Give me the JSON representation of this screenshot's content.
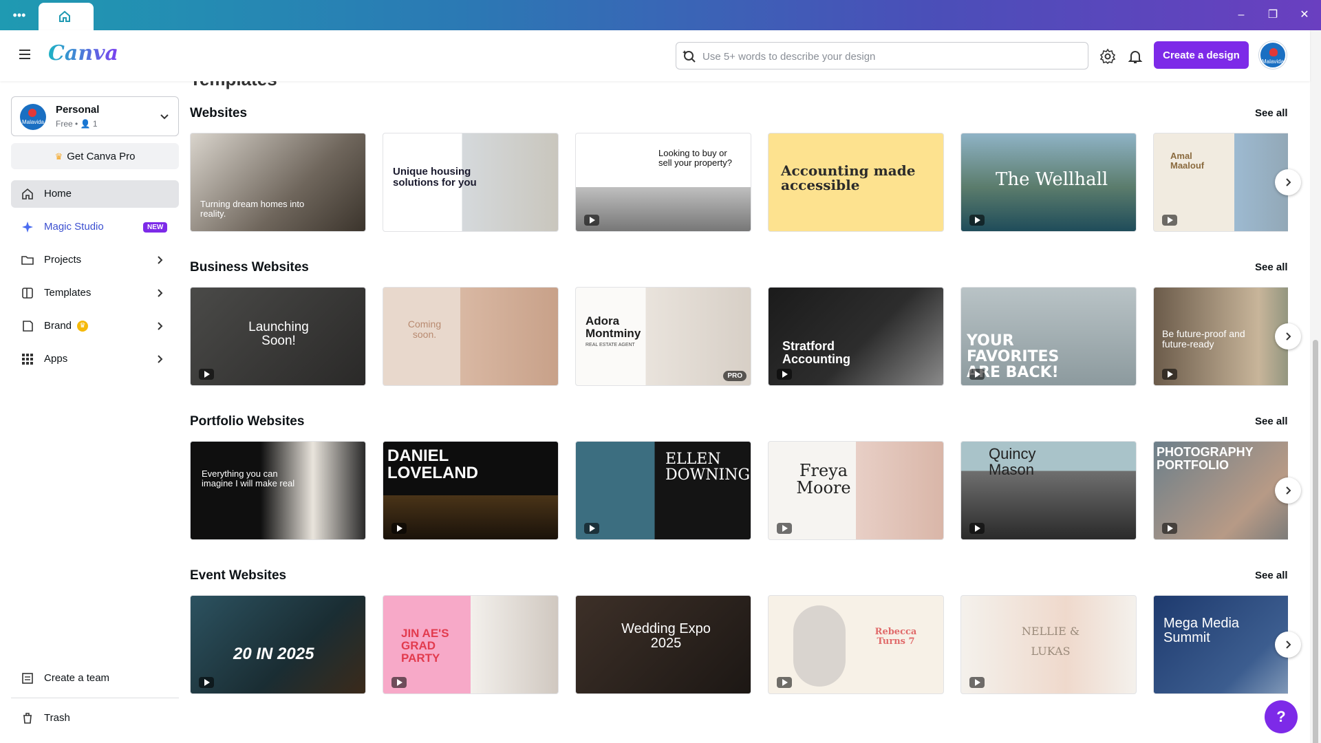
{
  "browser": {
    "tab_label": "Home"
  },
  "header": {
    "logo": "Canva",
    "search_placeholder": "Use 5+ words to describe your design",
    "create_label": "Create a design",
    "avatar_text": "Malavida"
  },
  "sidebar": {
    "account": {
      "name": "Personal",
      "plan": "Free • 👤 1",
      "avatar_text": "Malavida"
    },
    "get_pro": "Get Canva Pro",
    "items": [
      {
        "label": "Home",
        "icon": "home-icon"
      },
      {
        "label": "Magic Studio",
        "icon": "sparkle-icon",
        "badge": "NEW"
      },
      {
        "label": "Projects",
        "icon": "folder-icon"
      },
      {
        "label": "Templates",
        "icon": "templates-icon"
      },
      {
        "label": "Brand",
        "icon": "brand-icon"
      },
      {
        "label": "Apps",
        "icon": "apps-icon"
      }
    ],
    "bottom": [
      {
        "label": "Create a team",
        "icon": "team-icon"
      },
      {
        "label": "Trash",
        "icon": "trash-icon"
      }
    ]
  },
  "main": {
    "cut_title": "Templates",
    "see_all": "See all",
    "sections": [
      {
        "title": "Websites",
        "cards": [
          {
            "text": "Turning dream homes into reality."
          },
          {
            "text": "Unique housing solutions for you"
          },
          {
            "text": "Looking to buy or sell your property?"
          },
          {
            "text": "Accounting made accessible"
          },
          {
            "text": "The Wellhall"
          },
          {
            "text": "Amal Maalouf"
          }
        ]
      },
      {
        "title": "Business Websites",
        "cards": [
          {
            "text": "Launching Soon!"
          },
          {
            "text": "Coming soon."
          },
          {
            "text": "Adora Montminy",
            "sub": "REAL ESTATE AGENT",
            "tag": "PRO"
          },
          {
            "text": "Stratford Accounting"
          },
          {
            "text": "YOUR FAVORITES ARE BACK!"
          },
          {
            "text": "Be future-proof and future-ready"
          }
        ]
      },
      {
        "title": "Portfolio Websites",
        "cards": [
          {
            "text": "Everything you can imagine I will make real"
          },
          {
            "text": "DANIEL LOVELAND"
          },
          {
            "text": "ELLEN DOWNING"
          },
          {
            "text": "Freya Moore"
          },
          {
            "text": "Quincy Mason"
          },
          {
            "text": "PHOTOGRAPHY PORTFOLIO"
          }
        ]
      },
      {
        "title": "Event Websites",
        "cards": [
          {
            "text": "20 IN 2025"
          },
          {
            "text": "JIN AE'S GRAD PARTY"
          },
          {
            "text": "Wedding Expo 2025"
          },
          {
            "text": "Rebecca Turns 7"
          },
          {
            "text": "NELLIE & LUKAS"
          },
          {
            "text": "Mega Media Summit"
          }
        ]
      }
    ]
  },
  "help_label": "?"
}
